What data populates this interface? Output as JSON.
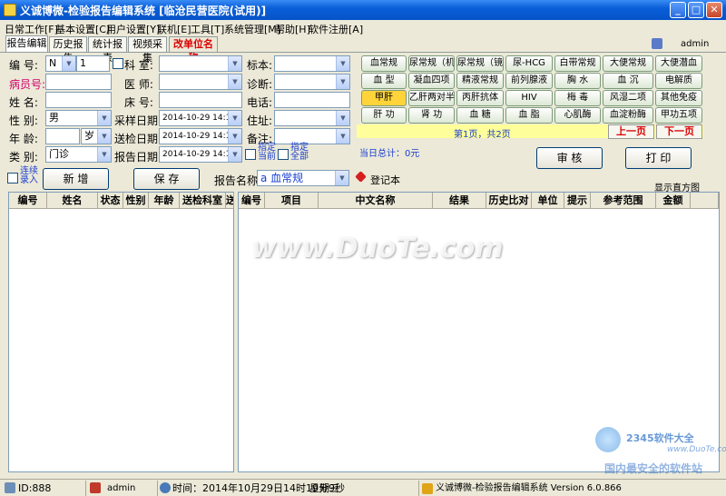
{
  "window": {
    "title": "义诚博微-检验报告编辑系统  [临沧民营医院(试用)]"
  },
  "menu": [
    "日常工作[F]",
    "基本设置[C]",
    "用户设置[Y]",
    "联机[E]",
    "工具[T]",
    "系统管理[M]",
    "帮助[H]",
    "软件注册[A]"
  ],
  "user": {
    "name": "admin"
  },
  "tabs": [
    "报告编辑",
    "历史报告",
    "统计报表",
    "视频采集",
    "改单位名称"
  ],
  "form": {
    "number_label": "编 号:",
    "number_prefix": "N",
    "number_value": "1",
    "department_label": "科 室:",
    "specimen_label": "标本:",
    "case_label": "病员号:",
    "doctor_label": "医 师:",
    "diagnosis_label": "诊断:",
    "name_label": "姓 名:",
    "bed_label": "床 号:",
    "phone_label": "电话:",
    "gender_label": "性 别:",
    "gender_value": "男",
    "sample_date_label": "采样日期:",
    "sample_date_value": "2014-10-29 14:19",
    "address_label": "住址:",
    "age_label": "年 龄:",
    "age_unit": "岁",
    "send_date_label": "送检日期:",
    "send_date_value": "2014-10-29 14:19",
    "remark_label": "备注:",
    "category_label": "类 别:",
    "category_value": "门诊",
    "report_date_label": "报告日期:",
    "report_date_value": "2014-10-29 14:19",
    "specify_current_line1": "指定",
    "specify_current_line2": "当前",
    "specify_all_line1": "指定",
    "specify_all_line2": "全部",
    "continuous_line1": "连续",
    "continuous_line2": "录入",
    "add_button": "新 增",
    "save_button": "保 存",
    "report_name_label": "报告名称:",
    "report_name_value": "a 血常规",
    "register_label": "登记本"
  },
  "test_buttons": [
    [
      "血常规",
      "尿常规（机）",
      "尿常规（镜）",
      "尿-HCG",
      "白带常规",
      "大便常规",
      "大便潜血"
    ],
    [
      "血 型",
      "凝血四项",
      "精液常规",
      "前列腺液",
      "胸 水",
      "血 沉",
      "电解质"
    ],
    [
      "甲肝",
      "乙肝两对半",
      "丙肝抗体",
      "HIV",
      "梅 毒",
      "风湿二项",
      "其他免疫"
    ],
    [
      "肝 功",
      "肾 功",
      "血 糖",
      "血 脂",
      "心肌酶",
      "血淀粉酶",
      "甲功五项"
    ]
  ],
  "pager": {
    "text": "第1页，共2页",
    "prev": "上一页",
    "next": "下一页"
  },
  "daily_total": "当日总计：0元",
  "review_button": "审 核",
  "print_button": "打 印",
  "histogram_label": "显示直方图",
  "left_table": {
    "columns": [
      "编号",
      "姓名",
      "状态",
      "性别",
      "年龄",
      "送检科室",
      "送"
    ]
  },
  "right_table": {
    "columns": [
      "编号",
      "项目",
      "中文名称",
      "结果",
      "历史比对",
      "单位",
      "提示",
      "参考范围",
      "金额"
    ]
  },
  "status": {
    "id": "ID:888",
    "user": "admin",
    "time": "时间：2014年10月29日14时19分9秒",
    "weekday": "星期三",
    "app": "义诚博微-检验报告编辑系统 Version 6.0.866"
  },
  "watermark": {
    "main": "www.DuoTe.com",
    "logo": "2345软件大全",
    "logo_url": "www.DuoTe.com",
    "slogan": "国内最安全的软件站"
  }
}
